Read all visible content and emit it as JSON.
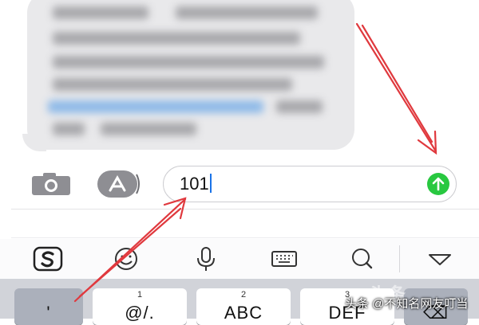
{
  "message_bubble": {
    "content": "blurred"
  },
  "composer": {
    "camera_icon": "camera-icon",
    "appstore_icon": "app-store-icon",
    "input_value": "101",
    "send_icon": "arrow-up-icon",
    "send_color": "#28c840"
  },
  "keyboard_toolbar": {
    "icons": [
      "sogou-logo-icon",
      "emoji-icon",
      "microphone-icon",
      "keyboard-icon",
      "search-icon",
      "collapse-triangle-icon"
    ]
  },
  "keypad": {
    "keys": [
      {
        "num": "",
        "label": "'"
      },
      {
        "num": "1",
        "label": "@/."
      },
      {
        "num": "2",
        "label": "ABC"
      },
      {
        "num": "3",
        "label": "DEF"
      },
      {
        "num": "",
        "label": "⌫"
      }
    ]
  },
  "watermark": {
    "text": "头条 @不知名网友叮当"
  },
  "annotation": {
    "arrow_color": "#e0393e"
  }
}
